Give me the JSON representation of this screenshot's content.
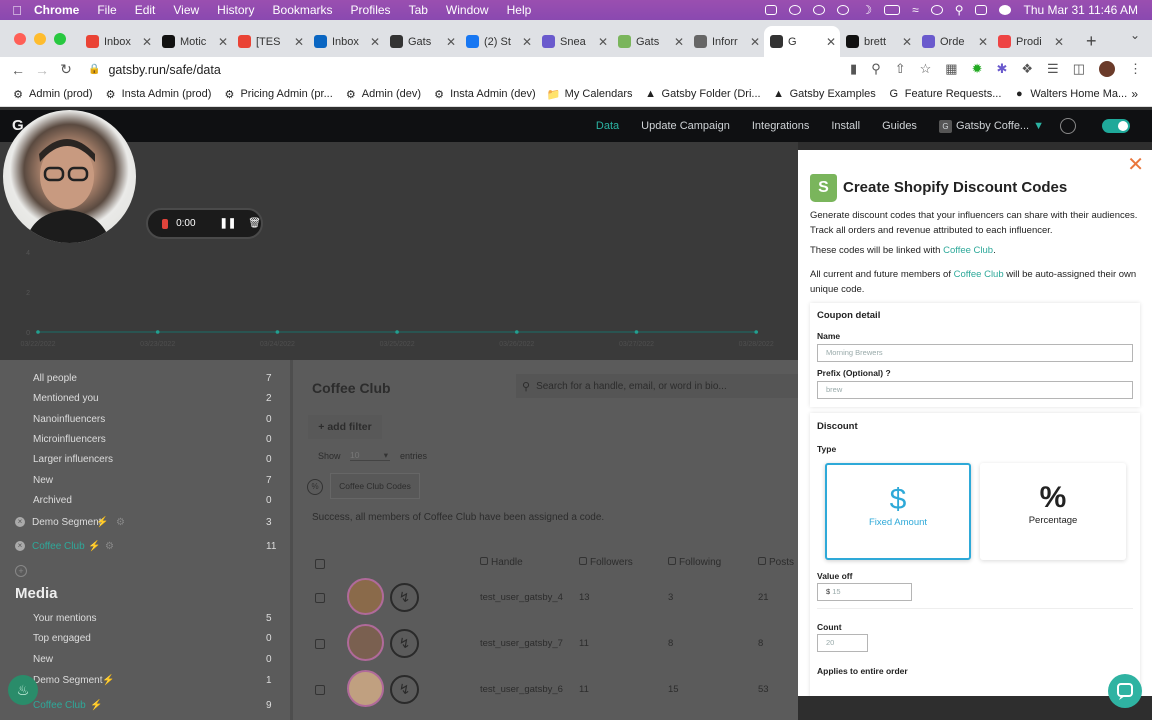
{
  "menubar": {
    "app": "Chrome",
    "items": [
      "File",
      "Edit",
      "View",
      "History",
      "Bookmarks",
      "Profiles",
      "Tab",
      "Window",
      "Help"
    ],
    "clock": "Thu Mar 31  11:46 AM"
  },
  "tabs": [
    {
      "label": "Inbox",
      "color": "#ea4335"
    },
    {
      "label": "Motic",
      "color": "#111"
    },
    {
      "label": "[TES",
      "color": "#ea4335"
    },
    {
      "label": "Inbox",
      "color": "#0a66c2"
    },
    {
      "label": "Gats",
      "color": "#333"
    },
    {
      "label": "(2) St",
      "color": "#1877f2"
    },
    {
      "label": "Snea",
      "color": "#6a5acd"
    },
    {
      "label": "Gats",
      "color": "#7ab55c"
    },
    {
      "label": "Inforr",
      "color": "#666"
    },
    {
      "label": "G",
      "color": "#333"
    },
    {
      "label": "brett",
      "color": "#111"
    },
    {
      "label": "Orde",
      "color": "#6a5acd"
    },
    {
      "label": "Prodi",
      "color": "#e44"
    }
  ],
  "address": {
    "url": "gatsby.run/safe/data"
  },
  "bookmarks": [
    "Admin (prod)",
    "Insta Admin (prod)",
    "Pricing Admin (pr...",
    "Admin (dev)",
    "Insta Admin (dev)",
    "My Calendars",
    "Gatsby Folder (Dri...",
    "Gatsby Examples",
    "Feature Requests...",
    "Walters Home Ma..."
  ],
  "appnav": {
    "logo": "G",
    "links": [
      "Data",
      "Update Campaign",
      "Integrations",
      "Install",
      "Guides"
    ],
    "account": "Gatsby Coffe..."
  },
  "recorder": {
    "time": "0:00"
  },
  "chart_data": {
    "type": "line",
    "categories": [
      "03/22/2022",
      "03/23/2022",
      "03/24/2022",
      "03/25/2022",
      "03/26/2022",
      "03/27/2022",
      "03/28/2022"
    ],
    "values": [
      0,
      0,
      0,
      0,
      0,
      0,
      0
    ],
    "y_ticks": [
      "0",
      "2",
      "4"
    ],
    "ylim": [
      0,
      4
    ]
  },
  "sidebar": {
    "items": [
      {
        "label": "All people",
        "count": "7"
      },
      {
        "label": "Mentioned you",
        "count": "2"
      },
      {
        "label": "Nanoinfluencers",
        "count": "0"
      },
      {
        "label": "Microinfluencers",
        "count": "0"
      },
      {
        "label": "Larger influencers",
        "count": "0"
      },
      {
        "label": "New",
        "count": "7"
      },
      {
        "label": "Archived",
        "count": "0"
      },
      {
        "label": "Demo Segment",
        "count": "3"
      },
      {
        "label": "Coffee Club",
        "count": "11"
      }
    ],
    "media_title": "Media",
    "media_items": [
      {
        "label": "Your mentions",
        "count": "5"
      },
      {
        "label": "Top engaged",
        "count": "0"
      },
      {
        "label": "New",
        "count": "0"
      },
      {
        "label": "Demo Segment",
        "count": "1"
      },
      {
        "label": "Coffee Club",
        "count": "9"
      }
    ]
  },
  "main": {
    "title": "Coffee Club",
    "search_placeholder": "Search for a handle, email, or word in bio...",
    "add_filter": "+ add filter",
    "show": "Show",
    "entries_value": "10",
    "entries": "entries",
    "codes_button": "Coffee Club Codes",
    "success": "Success, all members of Coffee Club have been assigned a code.",
    "columns": [
      "Handle",
      "Followers",
      "Following",
      "Posts"
    ],
    "rows": [
      {
        "handle": "test_user_gatsby_4",
        "followers": "13",
        "following": "3",
        "posts": "21"
      },
      {
        "handle": "test_user_gatsby_7",
        "followers": "11",
        "following": "8",
        "posts": "8"
      },
      {
        "handle": "test_user_gatsby_6",
        "followers": "11",
        "following": "15",
        "posts": "53"
      }
    ]
  },
  "modal": {
    "title": "Create Shopify Discount Codes",
    "intro": "Generate discount codes that your influencers can share with their audiences. Track all orders and revenue attributed to each influencer.",
    "linked_prefix": "These codes will be linked with ",
    "linked_name": "Coffee Club",
    "linked_suffix": ".",
    "assign_prefix": "All current and future members of ",
    "assign_name": "Coffee Club",
    "assign_suffix": " will be auto-assigned their own unique code.",
    "coupon_title": "Coupon detail",
    "name_label": "Name",
    "name_placeholder": "Morning Brewers",
    "prefix_label": "Prefix (Optional) ?",
    "prefix_placeholder": "brew",
    "discount_title": "Discount",
    "type_label": "Type",
    "fixed_symbol": "$",
    "fixed_label": "Fixed Amount",
    "pct_symbol": "%",
    "pct_label": "Percentage",
    "value_label": "Value off",
    "currency": "$",
    "value_placeholder": "15",
    "count_label": "Count",
    "count_placeholder": "20",
    "applies_label": "Applies to entire order"
  }
}
